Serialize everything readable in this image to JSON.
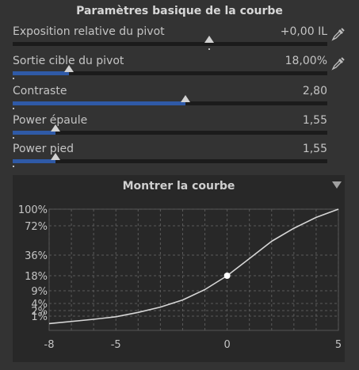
{
  "section": {
    "title": "Paramètres basique de la courbe"
  },
  "sliders": [
    {
      "id": "pivot-exposure",
      "label": "Exposition relative du pivot",
      "value": "+0,00 IL",
      "fraction": 0.625,
      "filled": false,
      "picker": true
    },
    {
      "id": "pivot-target",
      "label": "Sortie cible du pivot",
      "value": "18,00%",
      "fraction": 0.18,
      "filled": true,
      "picker": true
    },
    {
      "id": "contrast",
      "label": "Contraste",
      "value": "2,80",
      "fraction": 0.55,
      "filled": true,
      "picker": false
    },
    {
      "id": "shoulder-power",
      "label": "Power épaule",
      "value": "1,55",
      "fraction": 0.135,
      "filled": true,
      "picker": false
    },
    {
      "id": "toe-power",
      "label": "Power pied",
      "value": "1,55",
      "fraction": 0.135,
      "filled": true,
      "picker": false
    }
  ],
  "curve_panel": {
    "title": "Montrer la courbe"
  },
  "chart_data": {
    "type": "line",
    "title": "Montrer la courbe",
    "xlabel": "",
    "ylabel": "",
    "x_ticks": [
      -8,
      -5,
      0,
      5
    ],
    "y_ticks": [
      "100%",
      "72%",
      "36%",
      "18%",
      "9%",
      "4%",
      "2%",
      "1%"
    ],
    "xlim": [
      -8,
      5
    ],
    "pivot": {
      "x": 0,
      "y": 18
    },
    "series": [
      {
        "x": [
          -8,
          -6,
          -5,
          -4,
          -3,
          -2,
          -1,
          0,
          1,
          2,
          3,
          4,
          5
        ],
        "y": [
          0.3,
          0.6,
          0.9,
          1.6,
          2.8,
          5.0,
          9.5,
          18,
          32,
          50,
          68,
          85,
          100
        ]
      }
    ],
    "grid": true,
    "colors": {
      "curve": "#d6d6d6",
      "grid": "#5a5a5a"
    }
  }
}
